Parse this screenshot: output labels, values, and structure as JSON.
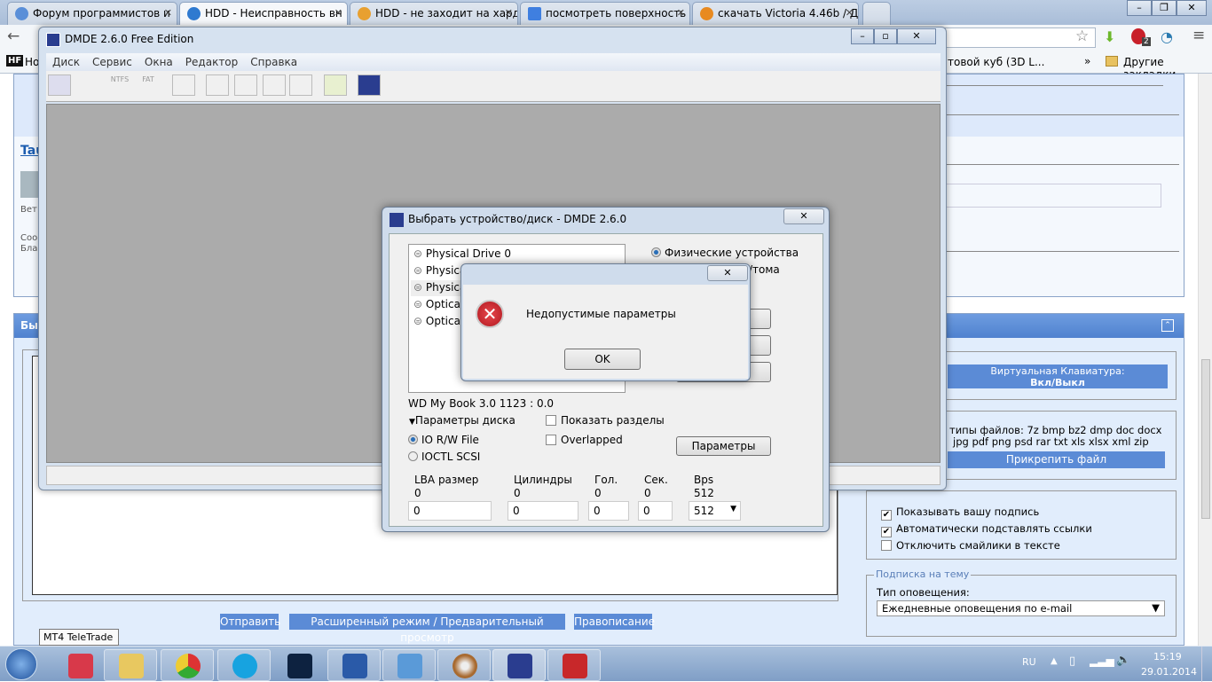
{
  "browser": {
    "tabs": [
      {
        "title": "Форум программистов и",
        "active": false,
        "color": "#5a8fd8"
      },
      {
        "title": "HDD - Неисправность вн",
        "active": true,
        "color": "#2f7ad0"
      },
      {
        "title": "HDD - не заходит на хард",
        "active": false,
        "color": "#e8a030"
      },
      {
        "title": "посмотреть поверхность",
        "active": false,
        "color": "#3f7fe0"
      },
      {
        "title": "скачать Victoria 4.46b / Д",
        "active": false,
        "color": "#e88a20"
      }
    ],
    "bookmarks": {
      "first": "Но",
      "hf": "HF",
      "middle": "товой куб (3D L...",
      "more": "»",
      "other": "Другие закладки"
    },
    "extension_badge": "2"
  },
  "forum": {
    "author_link": "Tau",
    "meta1": "Вет",
    "meta2": "Соо",
    "meta3": "Бла",
    "quick_reply_header": "Бы",
    "virtual_keyboard_line1": "Виртуальная Клавиатура:",
    "virtual_keyboard_line2": "Вкл/Выкл",
    "file_types_line1": "типы файлов: 7z bmp bz2 dmp doc docx",
    "file_types_line2": "jpg pdf png psd rar txt xls xlsx xml zip",
    "attach_button": "Прикрепить файл",
    "options": [
      {
        "label": "Показывать вашу подпись",
        "checked": true
      },
      {
        "label": "Автоматически подставлять ссылки",
        "checked": true
      },
      {
        "label": "Отключить смайлики в тексте",
        "checked": false
      }
    ],
    "subscription_legend": "Подписка на тему",
    "notify_label": "Тип оповещения:",
    "notify_value": "Ежедневные оповещения по e-mail",
    "buttons": {
      "send": "Отправить",
      "advanced": "Расширенный режим / Предварительный просмотр",
      "spelling": "Правописание"
    }
  },
  "tooltip": "MT4 TeleTrade",
  "dmde": {
    "title": "DMDE 2.6.0 Free Edition",
    "menu": [
      "Диск",
      "Сервис",
      "Окна",
      "Редактор",
      "Справка"
    ],
    "toolbar_labels": {
      "ntfs": "NTFS",
      "fat": "FAT"
    }
  },
  "device_dialog": {
    "title": "Выбрать устройство/диск - DMDE 2.6.0",
    "devices": [
      "Physical Drive 0",
      "Physical",
      "Physical",
      "Optica",
      "Optica"
    ],
    "radio_physical": "Физические устройства",
    "radio_logical_partial": "/тома",
    "selected_device": "WD My Book 3.0 1123 : 0.0",
    "disk_params": "Параметры диска",
    "show_partitions": "Показать разделы",
    "overlapped": "Overlapped",
    "io_rw": "IO R/W File",
    "ioctl": "IOCTL SCSI",
    "params_button": "Параметры",
    "columns": [
      {
        "label": "LBA размер",
        "value": "0",
        "input": "0"
      },
      {
        "label": "Цилиндры",
        "value": "0",
        "input": "0"
      },
      {
        "label": "Гол.",
        "value": "0",
        "input": "0"
      },
      {
        "label": "Сек.",
        "value": "0",
        "input": "0"
      },
      {
        "label": "Bps",
        "value": "512",
        "input": "512"
      }
    ]
  },
  "error_dialog": {
    "message": "Недопустимые параметры",
    "ok": "OK"
  },
  "taskbar": {
    "lang": "RU",
    "time": "15:19",
    "date": "29.01.2014"
  }
}
